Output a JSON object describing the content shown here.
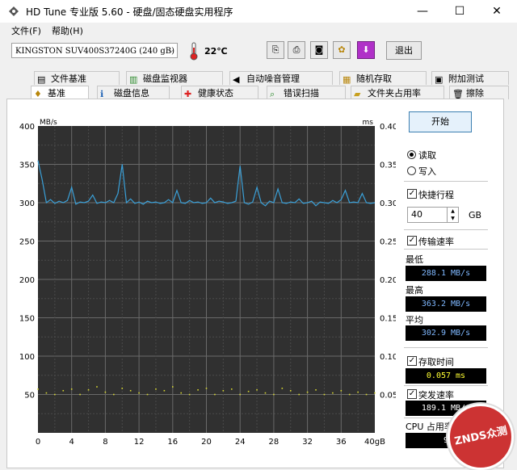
{
  "window": {
    "title": "HD Tune 专业版 5.60 - 硬盘/固态硬盘实用程序",
    "minimize": "—",
    "maximize": "☐",
    "close": "✕"
  },
  "menu": {
    "file": "文件(F)",
    "help": "帮助(H)"
  },
  "toolbar": {
    "drive": "KINGSTON SUV400S37240G (240 gB)",
    "temperature": "22℃",
    "exit": "退出"
  },
  "tabs_row1": [
    "文件基准",
    "磁盘监视器",
    "自动噪音管理",
    "随机存取",
    "附加测试"
  ],
  "tabs_row2": [
    "基准",
    "磁盘信息",
    "健康状态",
    "错误扫描",
    "文件夹占用率",
    "擦除"
  ],
  "active_tab": "基准",
  "chart": {
    "left_unit": "MB/s",
    "right_unit": "ms",
    "left_ticks": [
      "400",
      "350",
      "300",
      "250",
      "200",
      "150",
      "100",
      "50"
    ],
    "right_ticks": [
      "0.40",
      "0.35",
      "0.30",
      "0.25",
      "0.20",
      "0.15",
      "0.10",
      "0.05"
    ],
    "x_ticks": [
      "0",
      "4",
      "8",
      "12",
      "16",
      "20",
      "24",
      "28",
      "32",
      "36",
      "40gB"
    ]
  },
  "chart_data": {
    "type": "line",
    "x_unit": "gB",
    "xlim": [
      0,
      40
    ],
    "ylim": [
      0,
      400
    ],
    "y2lim": [
      0,
      0.4
    ],
    "grid": true,
    "series": [
      {
        "color": "#3aa0d8",
        "x": [
          0,
          0.5,
          1,
          1.5,
          2,
          2.5,
          3,
          3.5,
          4,
          4.5,
          5,
          5.5,
          6,
          6.5,
          7,
          7.5,
          8,
          8.5,
          9,
          9.5,
          10,
          10.5,
          11,
          11.5,
          12,
          12.5,
          13,
          13.5,
          14,
          14.5,
          15,
          15.5,
          16,
          16.5,
          17,
          17.5,
          18,
          18.5,
          19,
          19.5,
          20,
          20.5,
          21,
          21.5,
          22,
          22.5,
          23,
          23.5,
          24,
          24.5,
          25,
          25.5,
          26,
          26.5,
          27,
          27.5,
          28,
          28.5,
          29,
          29.5,
          30,
          30.5,
          31,
          31.5,
          32,
          32.5,
          33,
          33.5,
          34,
          34.5,
          35,
          35.5,
          36,
          36.5,
          37,
          37.5,
          38,
          38.5,
          39,
          39.5,
          40
        ],
        "values": [
          355,
          330,
          300,
          304,
          299,
          302,
          300,
          303,
          320,
          298,
          301,
          300,
          302,
          310,
          299,
          301,
          300,
          303,
          300,
          312,
          350,
          300,
          305,
          299,
          301,
          298,
          302,
          300,
          301,
          299,
          300,
          304,
          300,
          316,
          300,
          299,
          303,
          300,
          301,
          299,
          300,
          306,
          300,
          302,
          301,
          299,
          300,
          302,
          348,
          300,
          298,
          301,
          320,
          300,
          296,
          302,
          300,
          318,
          300,
          299,
          301,
          300,
          305,
          299,
          300,
          302,
          296,
          301,
          300,
          299,
          303,
          300,
          304,
          316,
          300,
          301,
          300,
          312,
          300,
          299,
          300
        ]
      },
      {
        "color": "#d8d830",
        "axis": "right",
        "x": [
          0,
          1,
          2,
          3,
          4,
          5,
          6,
          7,
          8,
          9,
          10,
          11,
          12,
          13,
          14,
          15,
          16,
          17,
          18,
          19,
          20,
          21,
          22,
          23,
          24,
          25,
          26,
          27,
          28,
          29,
          30,
          31,
          32,
          33,
          34,
          35,
          36,
          37,
          38,
          39,
          40
        ],
        "values": [
          0.057,
          0.052,
          0.05,
          0.055,
          0.057,
          0.05,
          0.056,
          0.06,
          0.053,
          0.05,
          0.058,
          0.055,
          0.052,
          0.05,
          0.057,
          0.055,
          0.06,
          0.052,
          0.05,
          0.056,
          0.058,
          0.05,
          0.055,
          0.057,
          0.05,
          0.054,
          0.056,
          0.052,
          0.05,
          0.058,
          0.055,
          0.05,
          0.053,
          0.056,
          0.05,
          0.052,
          0.055,
          0.05,
          0.053,
          0.05,
          0.052
        ]
      }
    ]
  },
  "controls": {
    "start": "开始",
    "read": "读取",
    "write": "写入",
    "short_stroke": "快捷行程",
    "stroke_value": "40",
    "stroke_unit": "GB",
    "transfer_rate": "传输速率",
    "min_label": "最低",
    "min_value": "288.1 MB/s",
    "max_label": "最高",
    "max_value": "363.2 MB/s",
    "avg_label": "平均",
    "avg_value": "302.9 MB/s",
    "access_time": "存取时间",
    "access_value": "0.057 ms",
    "burst_rate": "突发速率",
    "burst_value": "189.1 MB/s",
    "cpu_label": "CPU 占用率",
    "cpu_value": "9"
  },
  "watermark": "ZNDS众测"
}
